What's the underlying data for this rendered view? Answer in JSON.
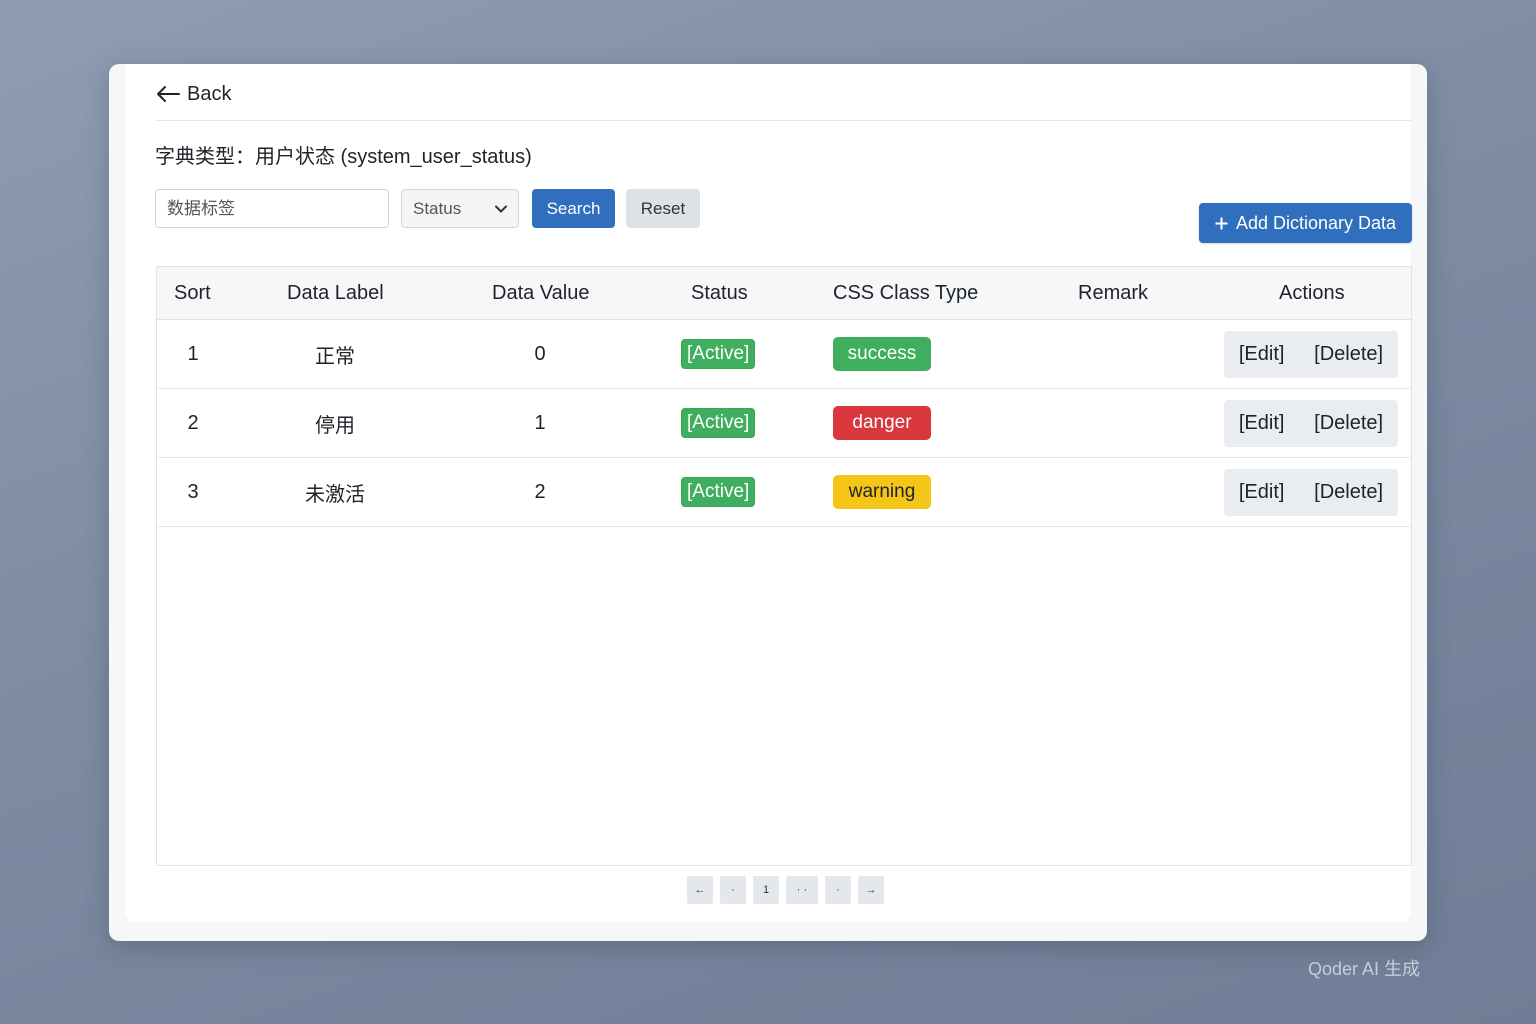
{
  "header": {
    "back_label": "Back",
    "title": "字典类型：用户状态 (system_user_status)"
  },
  "filters": {
    "label_placeholder": "数据标签",
    "status_select": "Status",
    "search_label": "Search",
    "reset_label": "Reset"
  },
  "toolbar": {
    "add_label": "Add Dictionary Data"
  },
  "table": {
    "columns": [
      "Sort",
      "Data Label",
      "Data Value",
      "Status",
      "CSS Class Type",
      "Remark",
      "Actions"
    ],
    "rows": [
      {
        "sort": "1",
        "label": "正常",
        "value": "0",
        "status": "[Active]",
        "css_class": "success",
        "css_color": "#3fae5e",
        "css_text": "#ffffff",
        "remark": "",
        "edit": "[Edit]",
        "delete": "[Delete]"
      },
      {
        "sort": "2",
        "label": "停用",
        "value": "1",
        "status": "[Active]",
        "css_class": "danger",
        "css_color": "#d9363e",
        "css_text": "#ffffff",
        "remark": "",
        "edit": "[Edit]",
        "delete": "[Delete]"
      },
      {
        "sort": "3",
        "label": "未激活",
        "value": "2",
        "status": "[Active]",
        "css_class": "warning",
        "css_color": "#f5c518",
        "css_text": "#1f2328",
        "remark": "",
        "edit": "[Edit]",
        "delete": "[Delete]"
      }
    ]
  },
  "pagination": {
    "items": [
      "←",
      "·",
      "1",
      "· ·",
      "·",
      "→"
    ]
  },
  "watermark": "Qoder AI 生成",
  "colors": {
    "primary": "#2f6fbd",
    "success": "#3fae5e",
    "danger": "#d9363e",
    "warning": "#f5c518"
  }
}
